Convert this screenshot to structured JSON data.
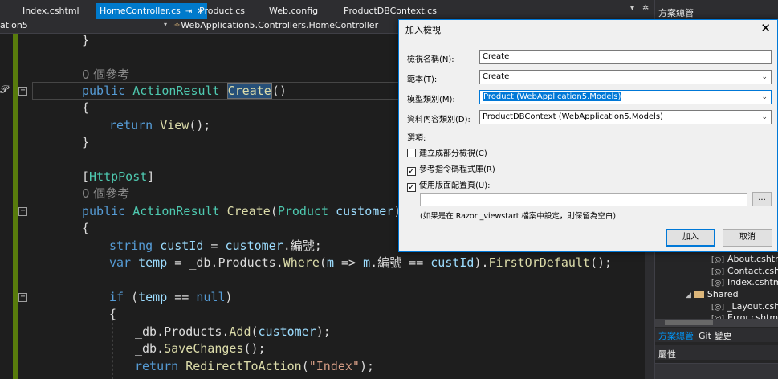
{
  "tabs": [
    {
      "label": "Index.cshtml"
    },
    {
      "label": "HomeController.cs",
      "active": true,
      "pin": "⇥",
      "close": "✕"
    },
    {
      "label": "Product.cs"
    },
    {
      "label": "Web.config"
    },
    {
      "label": "ProductDBContext.cs"
    }
  ],
  "tab_overflow": "▾",
  "tab_settings": "✲",
  "navbar": {
    "project": "ation5",
    "class_path": "WebApplication5.Controllers.HomeController"
  },
  "code": {
    "refs1": "0 個參考",
    "refs2": "0 個參考",
    "l_close0": "}",
    "l2_kw": "public",
    "l2_type": "ActionResult",
    "l2_method": "Create",
    "l2_paren": "()",
    "l3": "{",
    "l4_kw": "return",
    "l4_method": "View",
    "l4_rest": "();",
    "l5": "}",
    "attr_open": "[",
    "attr_name": "HttpPost",
    "attr_close": "]",
    "l8_kw": "public",
    "l8_type": "ActionResult",
    "l8_method": "Create",
    "l8_open": "(",
    "l8_ptype": "Product",
    "l8_pname": "customer",
    "l8_close": ")",
    "l9": "{",
    "l10_kw": "string",
    "l10_var": "custId",
    "l10_eq": " = ",
    "l10_obj": "customer",
    "l10_rest": ".編號;",
    "l11_kw": "var",
    "l11_var": "temp",
    "l11_a": " = _db.Products.",
    "l11_where": "Where",
    "l11_b": "(",
    "l11_m": "m",
    "l11_c": " => ",
    "l11_m2": "m",
    "l11_d": ".編號 == ",
    "l11_cust": "custId",
    "l11_e": ").",
    "l11_first": "FirstOrDefault",
    "l11_f": "();",
    "l13_kw": "if",
    "l13_a": " (",
    "l13_var": "temp",
    "l13_b": " == ",
    "l13_null": "null",
    "l13_c": ")",
    "l14": "{",
    "l15_a": "_db.Products.",
    "l15_method": "Add",
    "l15_b": "(",
    "l15_p": "customer",
    "l15_c": ");",
    "l16_a": "_db.",
    "l16_method": "SaveChanges",
    "l16_b": "();",
    "l17_kw": "return",
    "l17_method": "RedirectToAction",
    "l17_a": "(",
    "l17_str": "\"Index\"",
    "l17_b": ");"
  },
  "solution_explorer": {
    "title": "方案總管",
    "items": [
      {
        "label": "About.cshtml",
        "icon": "[@]"
      },
      {
        "label": "Contact.cshtml",
        "icon": "[@]"
      },
      {
        "label": "Index.cshtml",
        "icon": "[@]"
      },
      {
        "label": "Shared",
        "expander": "◢"
      },
      {
        "label": "_Layout.cshtml",
        "icon": "[@]"
      },
      {
        "label": "Error.cshtml",
        "icon": "[@]"
      }
    ],
    "tabs": [
      "方案總管",
      "Git 變更"
    ],
    "properties_title": "屬性"
  },
  "dialog": {
    "title": "加入檢視",
    "close": "✕",
    "view_name_label": "檢視名稱(N):",
    "view_name_value": "Create",
    "template_label": "範本(T):",
    "template_value": "Create",
    "model_label": "模型類別(M):",
    "model_value": "Product (WebApplication5.Models)",
    "context_label": "資料內容類別(D):",
    "context_value": "ProductDBContext (WebApplication5.Models)",
    "options_label": "選項:",
    "opt_partial": "建立成部分檢視(C)",
    "opt_partial_checked": false,
    "opt_scripts": "參考指令碼程式庫(R)",
    "opt_scripts_checked": true,
    "opt_layout": "使用版面配置頁(U):",
    "opt_layout_checked": true,
    "browse": "...",
    "hint": "(如果是在 Razor _viewstart 檔案中設定，則保留為空白)",
    "add_button": "加入",
    "cancel_button": "取消",
    "dropdown_arrow": "⌄",
    "check_mark": "✓"
  },
  "colors": {
    "accent": "#007acc",
    "change_bar": "#587c0c",
    "keyword": "#569cd6",
    "type": "#4ec9b0",
    "method": "#dcdcaa"
  }
}
